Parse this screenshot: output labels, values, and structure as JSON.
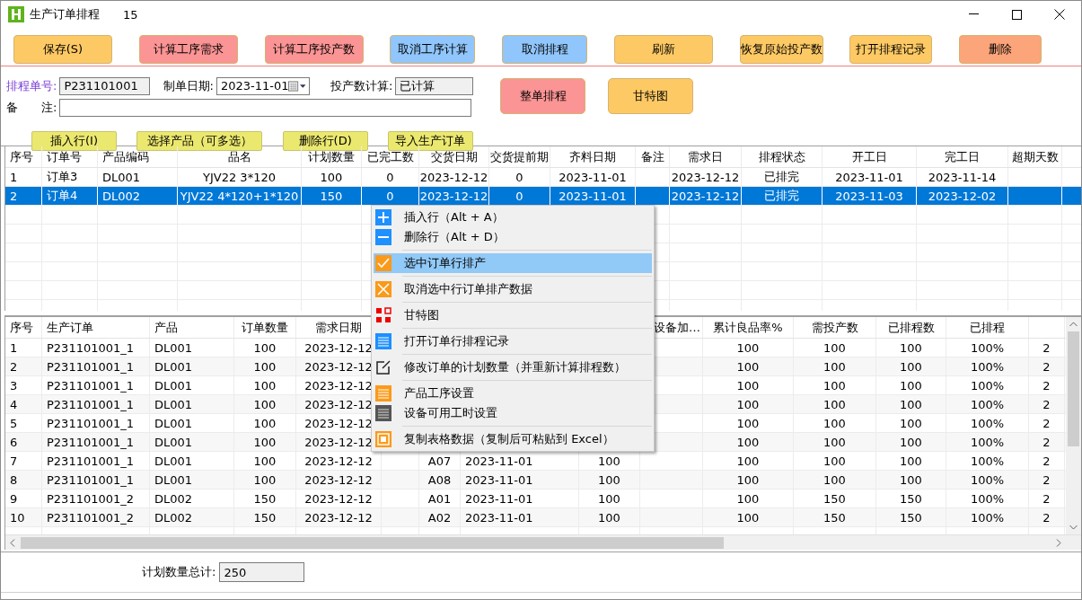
{
  "window": {
    "title": "生产订单排程",
    "count": "15"
  },
  "toolbar": [
    {
      "label": "保存(S)",
      "color": "#fdc964"
    },
    {
      "label": "计算工序需求",
      "color": "#fb9494"
    },
    {
      "label": "计算工序投产数",
      "color": "#fb9494"
    },
    {
      "label": "取消工序计算",
      "color": "#90c6fb"
    },
    {
      "label": "取消排程",
      "color": "#90c6fb"
    },
    {
      "label": "刷新",
      "color": "#fdc964"
    },
    {
      "label": "恢复原始投产数",
      "color": "#fdc964"
    },
    {
      "label": "打开排程记录",
      "color": "#fdc964"
    },
    {
      "label": "删除",
      "color": "#fca47a"
    }
  ],
  "form": {
    "schedule_no": {
      "label": "排程单号:",
      "value": "P231101001"
    },
    "order_date": {
      "label": "制单日期:",
      "value": "2023-11-01"
    },
    "calc_state": {
      "label": "投产数计算:",
      "value": "已计算"
    },
    "remark": {
      "label": "备　　注:"
    },
    "row_buttons": [
      {
        "label": "插入行(I)"
      },
      {
        "label": "选择产品（可多选）"
      },
      {
        "label": "删除行(D)"
      },
      {
        "label": "导入生产订单"
      }
    ],
    "action_buttons": [
      {
        "label": "整单排程",
        "color": "#fb9494"
      },
      {
        "label": "甘特图",
        "color": "#fdc964"
      }
    ]
  },
  "orders": {
    "columns": [
      "序号",
      "订单号",
      "产品编码",
      "品名",
      "计划数量",
      "已完工数",
      "交货日期",
      "交货提前期",
      "齐料日期",
      "备注",
      "需求日",
      "排程状态",
      "开工日",
      "完工日",
      "超期天数"
    ],
    "rows": [
      {
        "selected": false,
        "cells": [
          "1",
          "订单3",
          "DL001",
          "YJV22 3*120",
          "100",
          "0",
          "2023-12-12",
          "0",
          "2023-11-01",
          null,
          "2023-12-12",
          "已排完",
          "2023-11-01",
          "2023-11-14",
          null
        ]
      },
      {
        "selected": true,
        "cells": [
          "2",
          "订单4",
          "DL002",
          "YJV22 4*120+1*120",
          "150",
          "0",
          "2023-12-12",
          "0",
          "2023-11-01",
          null,
          "2023-12-12",
          "已排完",
          "2023-11-03",
          "2023-12-02",
          null
        ]
      }
    ]
  },
  "schedule": {
    "columns": [
      "序号",
      "生产订单",
      "产品",
      "订单数量",
      "需求日期",
      null,
      null,
      null,
      null,
      "设备加…",
      "累计良品率%",
      "需投产数",
      "已排程数",
      "已排程",
      null
    ],
    "rows": [
      {
        "cells": [
          "1",
          "P231101001_1",
          "DL001",
          "100",
          "2023-12-12",
          null,
          null,
          null,
          null,
          null,
          "100",
          "100",
          "100",
          "100%",
          "2"
        ]
      },
      {
        "cells": [
          "2",
          "P231101001_1",
          "DL001",
          "100",
          "2023-12-12",
          null,
          null,
          null,
          null,
          null,
          "100",
          "100",
          "100",
          "100%",
          "2"
        ]
      },
      {
        "cells": [
          "3",
          "P231101001_1",
          "DL001",
          "100",
          "2023-12-12",
          null,
          null,
          null,
          null,
          null,
          "100",
          "100",
          "100",
          "100%",
          "2"
        ]
      },
      {
        "cells": [
          "4",
          "P231101001_1",
          "DL001",
          "100",
          "2023-12-12",
          null,
          null,
          null,
          null,
          null,
          "100",
          "100",
          "100",
          "100%",
          "2"
        ]
      },
      {
        "cells": [
          "5",
          "P231101001_1",
          "DL001",
          "100",
          "2023-12-12",
          null,
          null,
          null,
          null,
          null,
          "100",
          "100",
          "100",
          "100%",
          "2"
        ]
      },
      {
        "cells": [
          "6",
          "P231101001_1",
          "DL001",
          "100",
          "2023-12-12",
          null,
          null,
          null,
          null,
          null,
          "100",
          "100",
          "100",
          "100%",
          "2"
        ]
      },
      {
        "cells": [
          "7",
          "P231101001_1",
          "DL001",
          "100",
          "2023-12-12",
          null,
          "A07",
          "2023-11-01",
          "100",
          null,
          "100",
          "100",
          "100",
          "100%",
          "2"
        ]
      },
      {
        "cells": [
          "8",
          "P231101001_1",
          "DL001",
          "100",
          "2023-12-12",
          null,
          "A08",
          "2023-11-01",
          "100",
          null,
          "100",
          "100",
          "100",
          "100%",
          "2"
        ]
      },
      {
        "cells": [
          "9",
          "P231101001_2",
          "DL002",
          "150",
          "2023-12-12",
          null,
          "A01",
          "2023-11-01",
          "100",
          null,
          "100",
          "150",
          "150",
          "100%",
          "2"
        ]
      },
      {
        "cells": [
          "10",
          "P231101001_2",
          "DL002",
          "150",
          "2023-12-12",
          null,
          "A02",
          "2023-11-01",
          "100",
          null,
          "100",
          "150",
          "150",
          "100%",
          "2"
        ]
      }
    ]
  },
  "context_menu": {
    "groups": [
      [
        {
          "label": "插入行（Alt + A）",
          "selected": false
        },
        {
          "label": "删除行（Alt + D）",
          "selected": false
        }
      ],
      [
        {
          "label": "选中订单行排产",
          "selected": true
        }
      ],
      [
        {
          "label": "取消选中行订单排产数据",
          "selected": false
        }
      ],
      [
        {
          "label": "甘特图",
          "selected": false
        }
      ],
      [
        {
          "label": "打开订单行排程记录",
          "selected": false
        }
      ],
      [
        {
          "label": "修改订单的计划数量（并重新计算排程数）",
          "selected": false
        }
      ],
      [
        {
          "label": "产品工序设置",
          "selected": false
        },
        {
          "label": "设备可用工时设置",
          "selected": false
        }
      ],
      [
        {
          "label": "复制表格数据（复制后可粘贴到 Excel）",
          "selected": false
        }
      ]
    ]
  },
  "total": {
    "label": "计划数量总计:",
    "value": "250"
  }
}
